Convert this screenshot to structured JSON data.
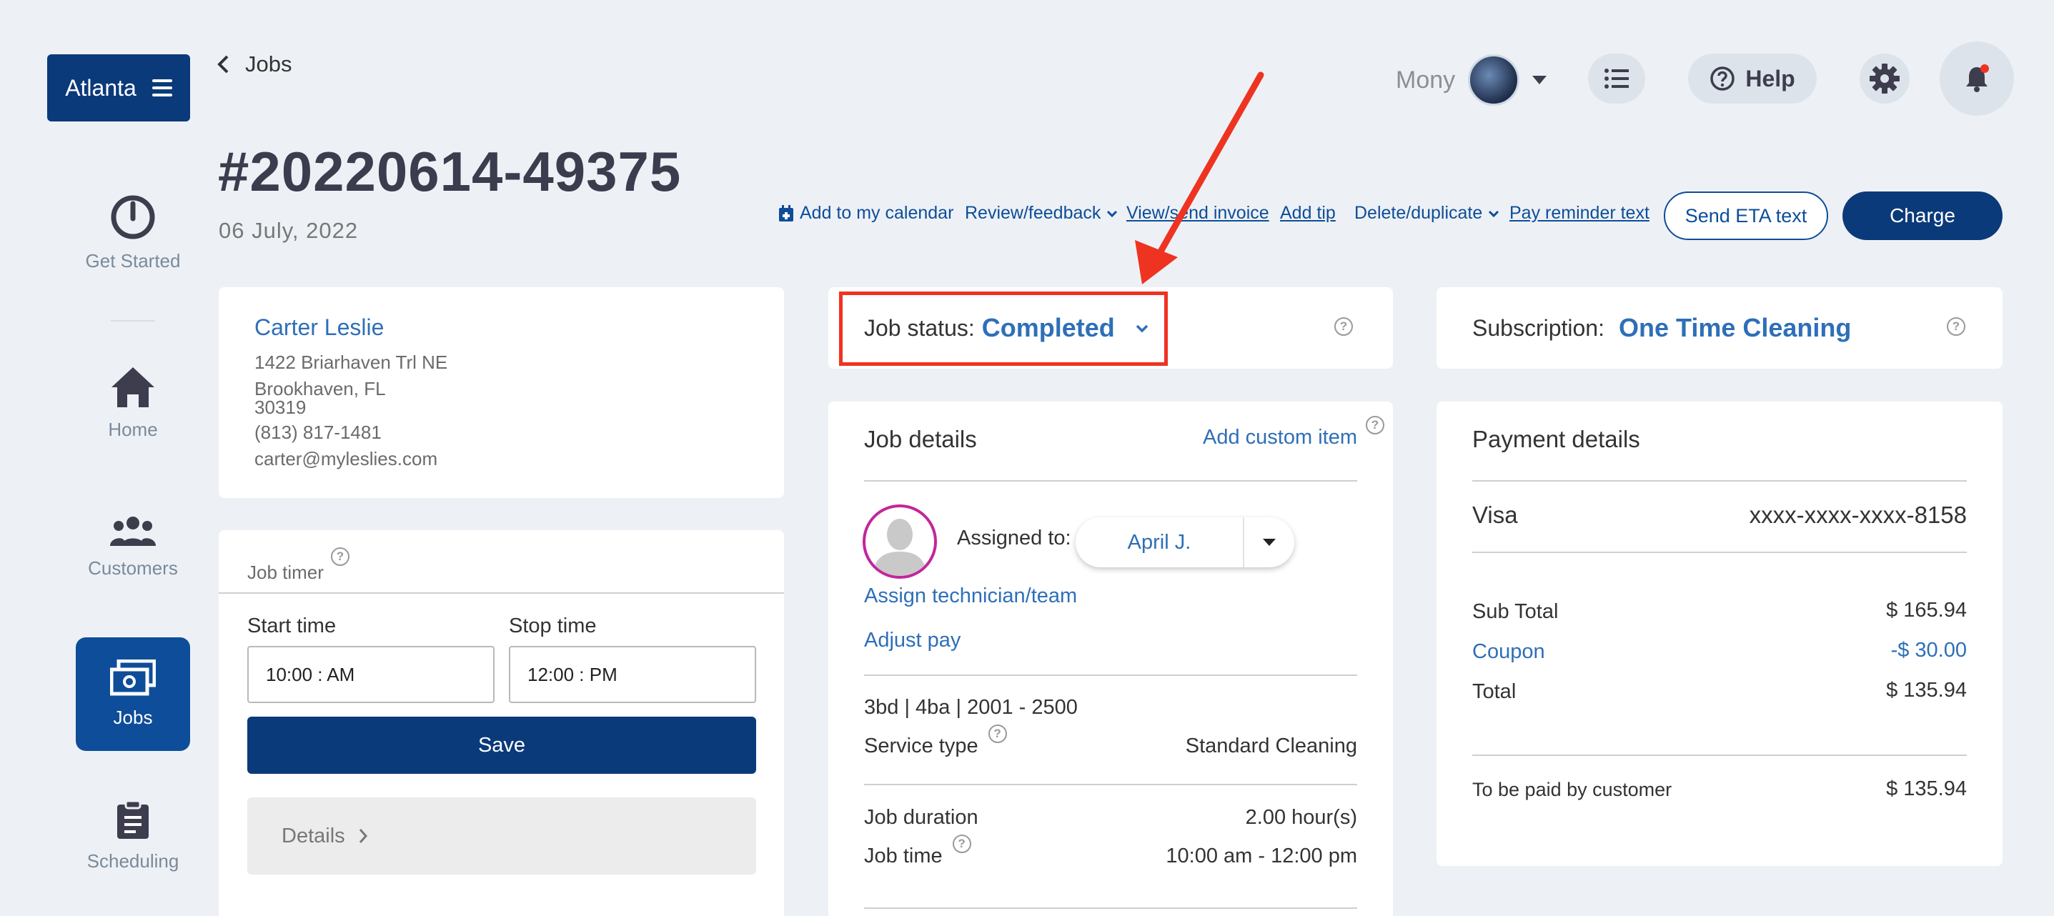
{
  "brand": {
    "label": "Atlanta"
  },
  "nav": {
    "get_started": "Get Started",
    "home": "Home",
    "customers": "Customers",
    "jobs": "Jobs",
    "scheduling": "Scheduling"
  },
  "header": {
    "back_label": "Jobs",
    "job_number": "#20220614-49375",
    "job_date": "06 July, 2022",
    "user_name": "Mony",
    "help_label": "Help"
  },
  "actions": {
    "add_calendar": "Add to my calendar",
    "review": "Review/feedback",
    "invoice": "View/send invoice",
    "add_tip": "Add tip",
    "delete_dup": "Delete/duplicate",
    "pay_reminder": "Pay reminder text",
    "send_eta": "Send ETA text",
    "charge": "Charge"
  },
  "customer": {
    "name": "Carter Leslie",
    "address1": "1422 Briarhaven Trl NE",
    "address2": "Brookhaven, FL",
    "zip": "30319",
    "phone": "(813) 817-1481",
    "email": "carter@myleslies.com"
  },
  "timer": {
    "title": "Job timer",
    "start_label": "Start time",
    "stop_label": "Stop time",
    "start_value": "10:00 : AM",
    "stop_value": "12:00 : PM",
    "save": "Save",
    "details": "Details"
  },
  "status": {
    "label": "Job status:",
    "value": "Completed"
  },
  "subscription": {
    "label": "Subscription:",
    "value": "One Time Cleaning"
  },
  "job_details": {
    "title": "Job details",
    "add_custom": "Add custom item",
    "assigned_label": "Assigned to:",
    "assigned_value": "April J.",
    "assign_link": "Assign technician/team",
    "adjust_pay": "Adjust pay",
    "size": "3bd | 4ba | 2001 - 2500",
    "service_type_label": "Service type",
    "service_type_value": "Standard Cleaning",
    "duration_label": "Job duration",
    "duration_value": "2.00 hour(s)",
    "time_label": "Job time",
    "time_value": "10:00 am - 12:00 pm"
  },
  "payment": {
    "title": "Payment details",
    "card_type": "Visa",
    "card_number": "xxxx-xxxx-xxxx-8158",
    "subtotal_label": "Sub Total",
    "subtotal_value": "$ 165.94",
    "coupon_label": "Coupon",
    "coupon_value": "-$ 30.00",
    "total_label": "Total",
    "total_value": "$ 135.94",
    "to_pay_label": "To be paid by customer",
    "to_pay_value": "$ 135.94"
  },
  "colors": {
    "primary": "#0b3a7a",
    "link": "#2e6fb8",
    "annotation": "#ef3321",
    "background": "#edf1f5"
  },
  "icons": [
    "menu-icon",
    "power-icon",
    "home-icon",
    "customers-icon",
    "jobs-icon",
    "clipboard-icon",
    "chevron-left-icon",
    "list-icon",
    "help-icon",
    "gear-icon",
    "bell-icon",
    "calendar-icon",
    "question-icon",
    "chevron-down-icon",
    "chevron-right-icon"
  ]
}
